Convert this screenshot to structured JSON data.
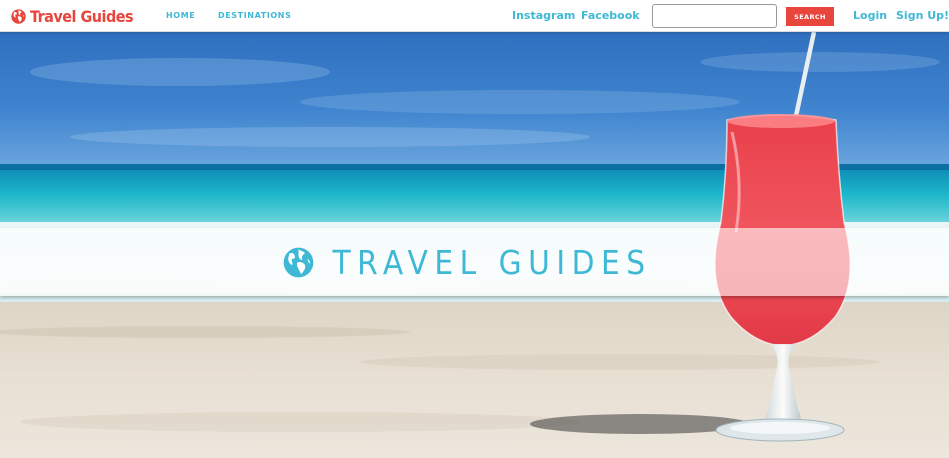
{
  "brand": {
    "name": "Travel Guides",
    "icon": "globe-icon",
    "color": "#e8453c"
  },
  "nav": {
    "items": [
      {
        "label": "HOME"
      },
      {
        "label": "DESTINATIONS"
      }
    ]
  },
  "social": {
    "instagram": "Instagram",
    "facebook": "Facebook"
  },
  "search": {
    "value": "",
    "placeholder": "",
    "button_label": "SEARCH"
  },
  "auth": {
    "login": "Login",
    "signup": "Sign Up!"
  },
  "hero": {
    "title": "TRAVEL GUIDES",
    "icon": "globe-icon",
    "image": "beach-cocktail-photo"
  },
  "colors": {
    "accent": "#3fb8d6",
    "brand_red": "#e8453c"
  }
}
